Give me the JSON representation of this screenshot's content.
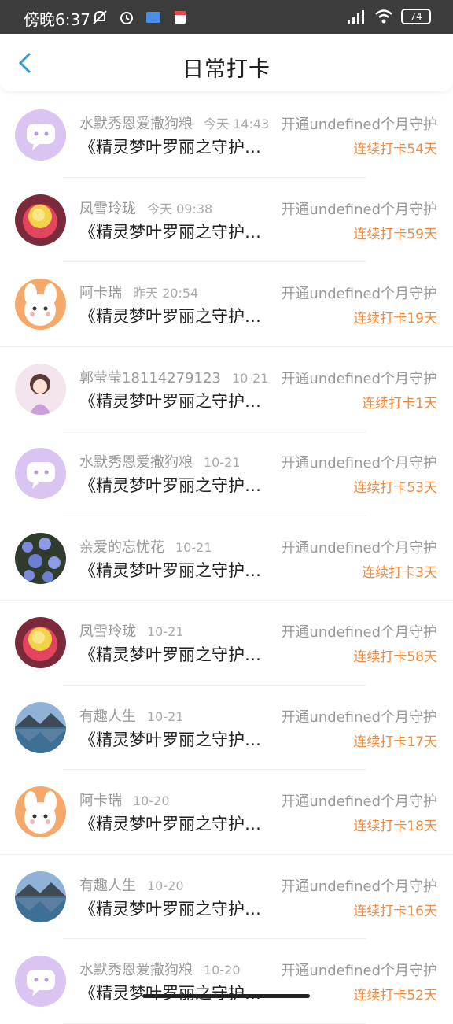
{
  "status_bar": {
    "time": "傍晚6:37",
    "battery": "74"
  },
  "header": {
    "title": "日常打卡"
  },
  "items": [
    {
      "name": "水默秀恩爱撒狗粮",
      "time": "今天 14:43",
      "desc": "《精灵梦叶罗丽之守护…",
      "guard": "开通undefined个月守护",
      "streak": "连续打卡54天",
      "avatar": "purple-chat"
    },
    {
      "name": "凤雪玲珑",
      "time": "今天 09:38",
      "desc": "《精灵梦叶罗丽之守护…",
      "guard": "开通undefined个月守护",
      "streak": "连续打卡59天",
      "avatar": "flower-rose"
    },
    {
      "name": "阿卡瑞",
      "time": "昨天 20:54",
      "desc": "《精灵梦叶罗丽之守护…",
      "guard": "开通undefined个月守护",
      "streak": "连续打卡19天",
      "avatar": "bunny"
    },
    {
      "name": "郭莹莹18114279123",
      "time": "10-21",
      "desc": "《精灵梦叶罗丽之守护…",
      "guard": "开通undefined个月守护",
      "streak": "连续打卡1天",
      "avatar": "anime-girl"
    },
    {
      "name": "水默秀恩爱撒狗粮",
      "time": "10-21",
      "desc": "《精灵梦叶罗丽之守护…",
      "guard": "开通undefined个月守护",
      "streak": "连续打卡53天",
      "avatar": "purple-chat"
    },
    {
      "name": "亲爱的忘忧花",
      "time": "10-21",
      "desc": "《精灵梦叶罗丽之守护…",
      "guard": "开通undefined个月守护",
      "streak": "连续打卡3天",
      "avatar": "blue-flowers"
    },
    {
      "name": "凤雪玲珑",
      "time": "10-21",
      "desc": "《精灵梦叶罗丽之守护…",
      "guard": "开通undefined个月守护",
      "streak": "连续打卡58天",
      "avatar": "flower-rose"
    },
    {
      "name": "有趣人生",
      "time": "10-21",
      "desc": "《精灵梦叶罗丽之守护…",
      "guard": "开通undefined个月守护",
      "streak": "连续打卡17天",
      "avatar": "lake-landscape"
    },
    {
      "name": "阿卡瑞",
      "time": "10-20",
      "desc": "《精灵梦叶罗丽之守护…",
      "guard": "开通undefined个月守护",
      "streak": "连续打卡18天",
      "avatar": "bunny"
    },
    {
      "name": "有趣人生",
      "time": "10-20",
      "desc": "《精灵梦叶罗丽之守护…",
      "guard": "开通undefined个月守护",
      "streak": "连续打卡16天",
      "avatar": "lake-landscape"
    },
    {
      "name": "水默秀恩爱撒狗粮",
      "time": "10-20",
      "desc": "《精灵梦叶罗丽之守护…",
      "guard": "开通undefined个月守护",
      "streak": "连续打卡52天",
      "avatar": "purple-chat"
    }
  ]
}
